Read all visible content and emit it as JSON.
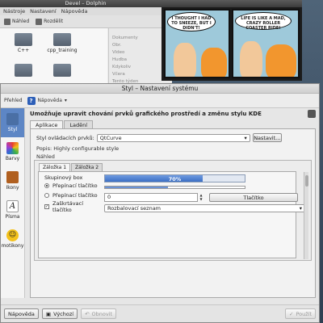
{
  "dolphin": {
    "title": "Devel – Dolphin",
    "menu": [
      "Nástroje",
      "Nastavení",
      "Nápověda"
    ],
    "toolbar": [
      "Náhled",
      "Rozdělit"
    ],
    "folders": [
      "C++",
      "cpp_training"
    ],
    "side": [
      "Dokumenty",
      "Obr.",
      "Video",
      "Hudba",
      "Kdykoliv",
      "Včera",
      "Tento týden"
    ]
  },
  "comic": {
    "bubble1": "I THOUGHT I HAD TO SNEEZE, BUT I DIDN'T!",
    "bubble2": "LIFE IS LIKE A MAD, CRAZY ROLLER COASTER RIDE!"
  },
  "main": {
    "title": "Styl – Nastavení systému",
    "toolbar": {
      "overview": "Přehled",
      "help": "Nápověda"
    },
    "categories": [
      {
        "label": "Styl",
        "icon": "style-icon",
        "color": "#4a6fa5"
      },
      {
        "label": "Barvy",
        "icon": "colors-icon",
        "color": "#e8402c"
      },
      {
        "label": "Ikony",
        "icon": "icons-icon",
        "color": "#b05f1f"
      },
      {
        "label": "Písma",
        "icon": "fonts-icon",
        "color": "#ffffff"
      },
      {
        "label": "motikony",
        "icon": "emoticons-icon",
        "color": "#f4c21b"
      }
    ],
    "headline": "Umožňuje upravit chování prvků grafického prostředí a změnu stylu KDE",
    "tabs": [
      "Aplikace",
      "Ladění"
    ],
    "style_label": "Styl ovládacích prvků:",
    "style_value": "QtCurve",
    "configure_button": "Nastavit...",
    "description": "Popis: Highly configurable style",
    "preview_label": "Náhled",
    "preview": {
      "tabs": [
        "Záložka 1",
        "Záložka 2"
      ],
      "group_title": "Skupinový box",
      "radio1": "Přepínací tlačítko",
      "radio2": "Přepínací tlačítko",
      "checkbox": "Zaškrtávací tlačítko",
      "progress": 0.7,
      "progress_text": "70%",
      "slider": 0.45,
      "spin_value": "0",
      "button": "Tlačítko",
      "combo": "Rozbalovací seznam"
    },
    "bottom": {
      "help": "Nápověda",
      "defaults": "Výchozí",
      "reset": "Obnovit",
      "apply": "Použít"
    }
  }
}
